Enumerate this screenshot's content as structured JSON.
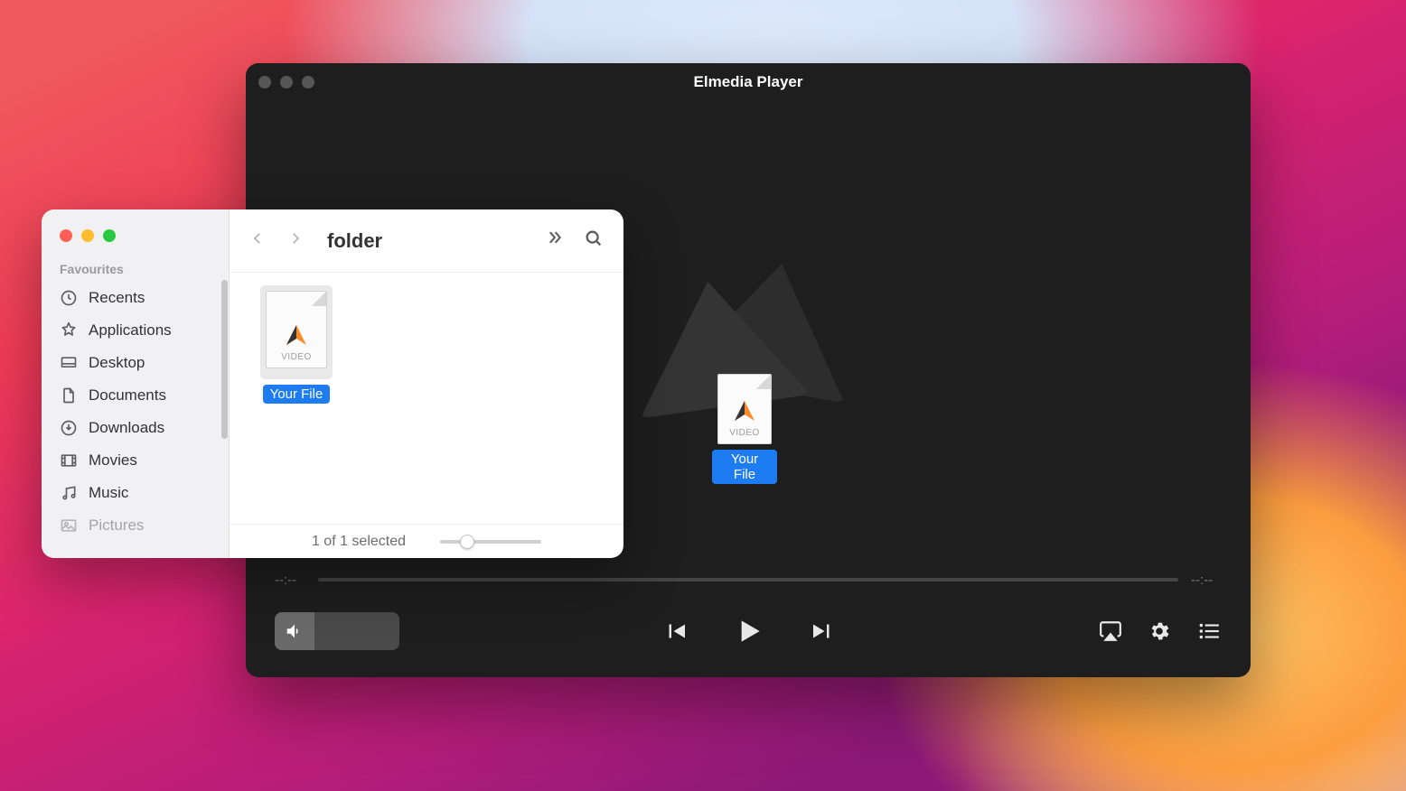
{
  "player": {
    "title": "Elmedia Player",
    "time_elapsed": "--:--",
    "time_remaining": "--:--",
    "dragged_file": {
      "type_label": "VIDEO",
      "name": "Your File"
    }
  },
  "finder": {
    "folder_title": "folder",
    "favourites_label": "Favourites",
    "sidebar": {
      "items": [
        {
          "label": "Recents",
          "icon": "clock"
        },
        {
          "label": "Applications",
          "icon": "apps"
        },
        {
          "label": "Desktop",
          "icon": "desktop"
        },
        {
          "label": "Documents",
          "icon": "document"
        },
        {
          "label": "Downloads",
          "icon": "downloads"
        },
        {
          "label": "Movies",
          "icon": "movies"
        },
        {
          "label": "Music",
          "icon": "music"
        },
        {
          "label": "Pictures",
          "icon": "pictures"
        }
      ]
    },
    "file": {
      "type_label": "VIDEO",
      "name": "Your File"
    },
    "status": "1 of 1 selected"
  }
}
